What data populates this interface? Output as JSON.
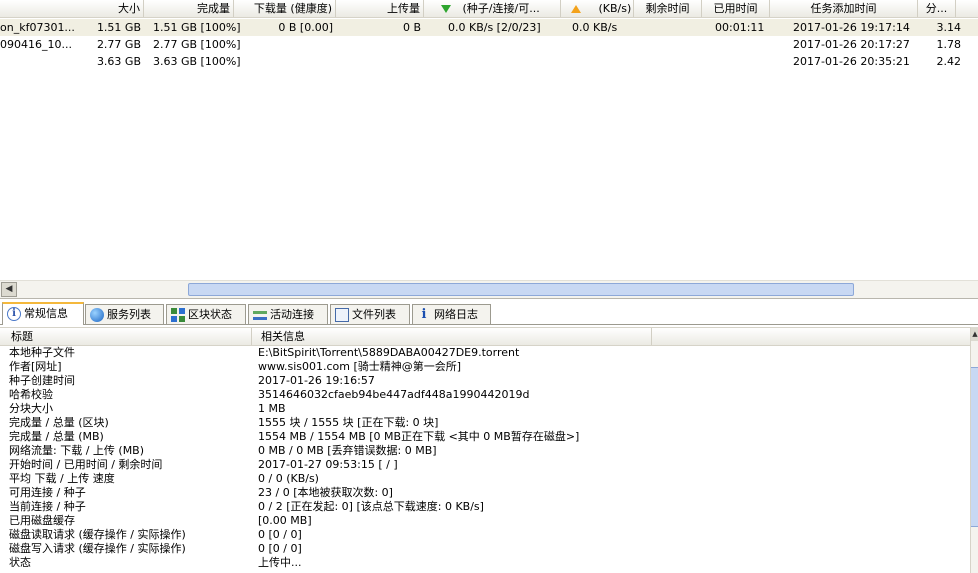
{
  "top_list": {
    "columns": [
      "大小",
      "完成量",
      "下载量 (健康度)",
      "上传量",
      "(种子/连接/可...",
      "(KB/s)",
      "剩余时间",
      "已用时间",
      "任务添加时间",
      "分..."
    ],
    "rows": [
      {
        "name": "on_kf07301...",
        "size": "1.51 GB",
        "done": "1.51 GB [100%]",
        "downloaded": "0 B [0.00]",
        "uploaded": "0 B",
        "down_speed": "0.0 KB/s [2/0/23]",
        "up_speed": "0.0 KB/s",
        "remaining": "",
        "elapsed": "00:01:11",
        "added": "2017-01-26 19:17:14",
        "share": "3.14"
      },
      {
        "name": "090416_10...",
        "size": "2.77 GB",
        "done": "2.77 GB [100%]",
        "downloaded": "",
        "uploaded": "",
        "down_speed": "",
        "up_speed": "",
        "remaining": "",
        "elapsed": "",
        "added": "2017-01-26 20:17:27",
        "share": "1.78"
      },
      {
        "name": "",
        "size": "3.63 GB",
        "done": "3.63 GB [100%]",
        "downloaded": "",
        "uploaded": "",
        "down_speed": "",
        "up_speed": "",
        "remaining": "",
        "elapsed": "",
        "added": "2017-01-26 20:35:21",
        "share": "2.42"
      }
    ]
  },
  "tabs": [
    {
      "label": "常规信息",
      "icon": "info-icon"
    },
    {
      "label": "服务列表",
      "icon": "globe-icon"
    },
    {
      "label": "区块状态",
      "icon": "blocks-icon"
    },
    {
      "label": "活动连接",
      "icon": "connections-icon"
    },
    {
      "label": "文件列表",
      "icon": "files-icon"
    },
    {
      "label": "网络日志",
      "icon": "log-icon"
    }
  ],
  "info": {
    "col_title": "标题",
    "col_info": "相关信息",
    "rows": [
      {
        "k": "本地种子文件",
        "v": "E:\\BitSpirit\\Torrent\\5889DABA00427DE9.torrent"
      },
      {
        "k": "作者[网址]",
        "v": "www.sis001.com [骑士精神@第一会所]"
      },
      {
        "k": "种子创建时间",
        "v": "2017-01-26 19:16:57"
      },
      {
        "k": "哈希校验",
        "v": "3514646032cfaeb94be447adf448a1990442019d"
      },
      {
        "k": "分块大小",
        "v": "1 MB"
      },
      {
        "k": "完成量 / 总量 (区块)",
        "v": "1555 块 / 1555 块 [正在下载: 0 块]"
      },
      {
        "k": "完成量 / 总量 (MB)",
        "v": "1554 MB / 1554 MB [0 MB正在下载 <其中 0 MB暂存在磁盘>]"
      },
      {
        "k": "网络流量: 下载 / 上传 (MB)",
        "v": "0 MB / 0 MB [丢弃错误数据: 0 MB]"
      },
      {
        "k": "开始时间 / 已用时间 / 剩余时间",
        "v": "2017-01-27 09:53:15 [ / ]"
      },
      {
        "k": "平均 下载 / 上传 速度",
        "v": "0 / 0 (KB/s)"
      },
      {
        "k": "可用连接 / 种子",
        "v": "23 / 0 [本地被获取次数: 0]"
      },
      {
        "k": "当前连接 / 种子",
        "v": "0 / 2 [正在发起: 0] [该点总下载速度: 0 KB/s]"
      },
      {
        "k": "已用磁盘缓存",
        "v": "[0.00 MB]"
      },
      {
        "k": "磁盘读取请求 (缓存操作 / 实际操作)",
        "v": "0 [0 / 0]"
      },
      {
        "k": "磁盘写入请求 (缓存操作 / 实际操作)",
        "v": "0 [0 / 0]"
      },
      {
        "k": "状态",
        "v": "上传中..."
      }
    ]
  }
}
